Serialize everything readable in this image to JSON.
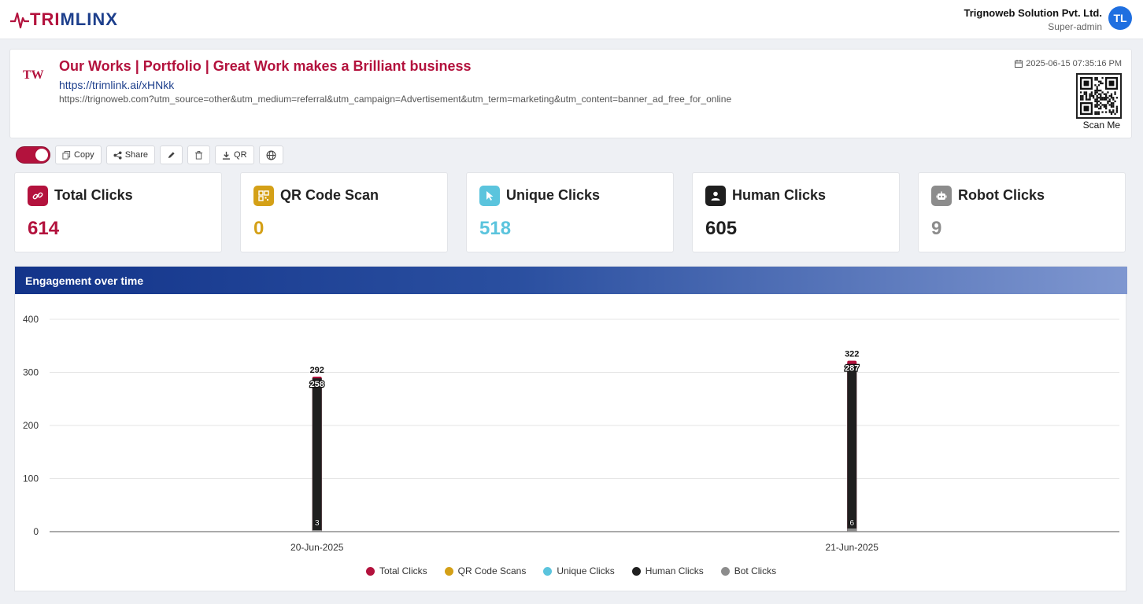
{
  "header": {
    "logo_left": "TR",
    "logo_mid": "I",
    "logo_right": "MLINX",
    "org_name": "Trignoweb Solution Pvt. Ltd.",
    "role": "Super-admin",
    "avatar": "TL"
  },
  "link": {
    "brand_mark_a": "T",
    "brand_mark_b": "W",
    "title": "Our Works | Portfolio | Great Work makes a Brilliant business",
    "short_url": "https://trimlink.ai/xHNkk",
    "long_url": "https://trignoweb.com?utm_source=other&utm_medium=referral&utm_campaign=Advertisement&utm_term=marketing&utm_content=banner_ad_free_for_online",
    "created": "2025-06-15 07:35:16 PM",
    "scan_label": "Scan Me"
  },
  "toolbar": {
    "copy": "Copy",
    "share": "Share",
    "qr": "QR"
  },
  "stats": [
    {
      "label": "Total Clicks",
      "value": "614",
      "color": "#b3123d",
      "icon": "link-icon"
    },
    {
      "label": "QR Code Scan",
      "value": "0",
      "color": "#d4a017",
      "icon": "qr-icon"
    },
    {
      "label": "Unique Clicks",
      "value": "518",
      "color": "#5bc4dd",
      "icon": "cursor-icon"
    },
    {
      "label": "Human Clicks",
      "value": "605",
      "color": "#1f1f1f",
      "icon": "person-icon"
    },
    {
      "label": "Robot Clicks",
      "value": "9",
      "color": "#8c8c8c",
      "icon": "robot-icon"
    }
  ],
  "chart": {
    "title": "Engagement over time"
  },
  "chart_data": {
    "type": "bar",
    "categories": [
      "20-Jun-2025",
      "21-Jun-2025"
    ],
    "series": [
      {
        "name": "Total Clicks",
        "color": "#b3123d",
        "values": [
          292,
          322
        ]
      },
      {
        "name": "QR Code Scans",
        "color": "#d4a017",
        "values": [
          0,
          0
        ]
      },
      {
        "name": "Unique Clicks",
        "color": "#5bc4dd",
        "values": [
          258,
          260
        ]
      },
      {
        "name": "Human Clicks",
        "color": "#1f1f1f",
        "values": [
          289,
          316
        ]
      },
      {
        "name": "Bot Clicks",
        "color": "#8c8c8c",
        "values": [
          3,
          6
        ]
      }
    ],
    "data_labels": [
      {
        "category": "20-Jun-2025",
        "top": "292",
        "mid": "258",
        "bottom": "3"
      },
      {
        "category": "21-Jun-2025",
        "top": "322",
        "mid": "287",
        "bottom": "6"
      }
    ],
    "y_ticks": [
      "0",
      "100",
      "200",
      "300",
      "400"
    ],
    "ylim": [
      0,
      400
    ],
    "grid": true,
    "legend": "bottom"
  }
}
